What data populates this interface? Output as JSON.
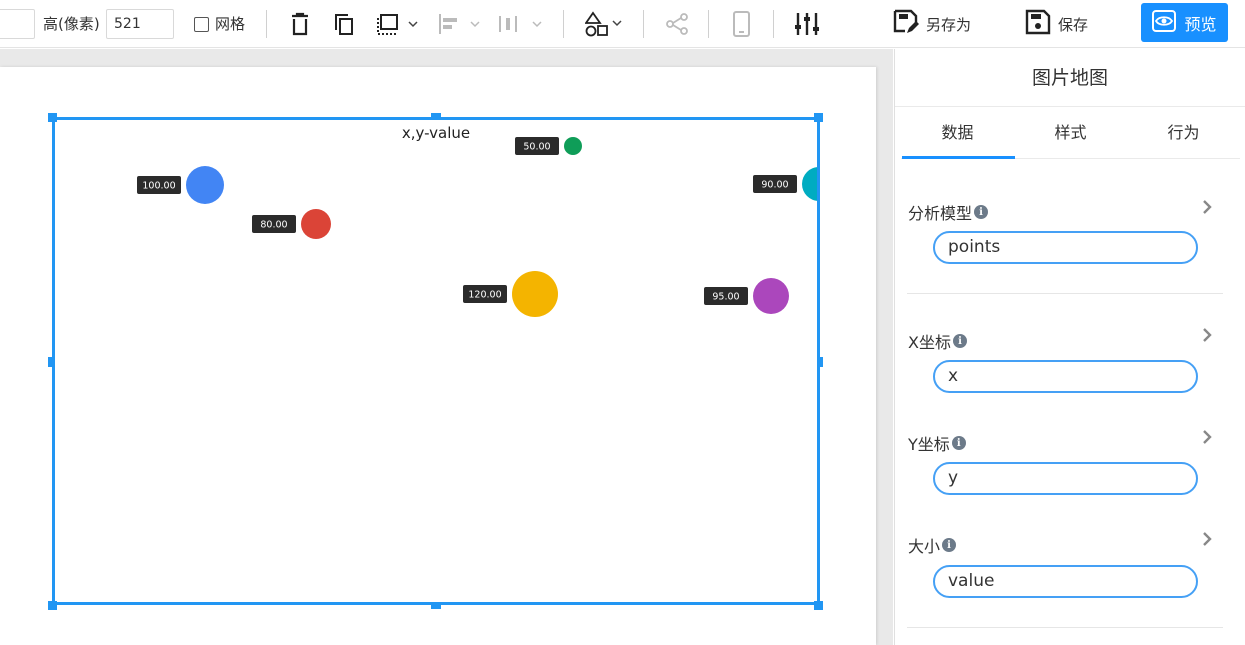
{
  "toolbar": {
    "width_value": "",
    "height_label": "高(像素)",
    "height_value": "521",
    "grid_label": "网格",
    "save_as_label": "另存为",
    "save_label": "保存",
    "preview_label": "预览",
    "icons": [
      "delete-icon",
      "copy-icon",
      "select-icon",
      "align-left-icon",
      "align-center-icon",
      "shapes-icon",
      "share-icon",
      "mobile-icon",
      "settings-sliders-icon"
    ]
  },
  "chart_data": {
    "type": "scatter",
    "title": "x,y-value",
    "points": [
      {
        "label": "100.00",
        "value": 100,
        "color": "#4285f4"
      },
      {
        "label": "80.00",
        "value": 80,
        "color": "#db4437"
      },
      {
        "label": "50.00",
        "value": 50,
        "color": "#0f9d58"
      },
      {
        "label": "120.00",
        "value": 120,
        "color": "#f4b400"
      },
      {
        "label": "90.00",
        "value": 90,
        "color": "#00acc1"
      },
      {
        "label": "95.00",
        "value": 95,
        "color": "#ab47bc"
      }
    ]
  },
  "panel": {
    "title": "图片地图",
    "tabs": [
      "数据",
      "样式",
      "行为"
    ],
    "active_tab": "数据",
    "fields": [
      {
        "label": "分析模型",
        "value": "points"
      },
      {
        "label": "X坐标",
        "value": "x"
      },
      {
        "label": "Y坐标",
        "value": "y"
      },
      {
        "label": "大小",
        "value": "value"
      }
    ]
  }
}
